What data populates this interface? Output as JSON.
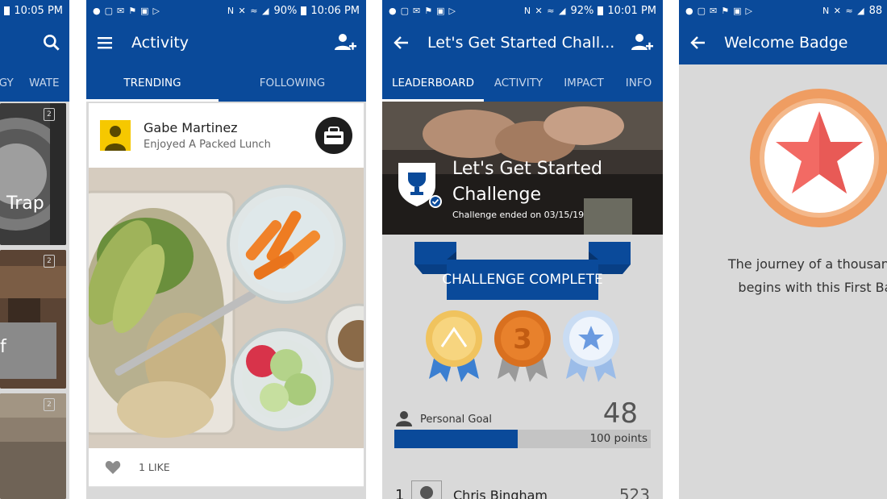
{
  "colors": {
    "brand_blue": "#0a4a9a",
    "tab_inactive": "#c6d5ea",
    "badge_orange": "#ef9d62",
    "star_red": "#f26a64"
  },
  "screens": [
    {
      "status_time": "10:05 PM",
      "tabs": [
        "RGY",
        "WATE"
      ],
      "card_badge": "2",
      "card_text_1": "Trap",
      "card_text_2": "f"
    },
    {
      "status_battery": "90%",
      "status_time": "10:06 PM",
      "title": "Activity",
      "tabs": [
        "TRENDING",
        "FOLLOWING"
      ],
      "post": {
        "user": "Gabe Martinez",
        "action": "Enjoyed A Packed Lunch",
        "likes_label": "1 LIKE"
      }
    },
    {
      "status_battery": "92%",
      "status_time": "10:01 PM",
      "title": "Let's Get Started Chall...",
      "tabs": [
        "LEADERBOARD",
        "ACTIVITY",
        "IMPACT",
        "INFO"
      ],
      "hero_title": "Let's Get Started Challenge",
      "hero_sub": "Challenge ended on 03/15/19",
      "banner": "CHALLENGE COMPLETE",
      "medal_icons": [
        "mountain-medal-icon",
        "number-3-medal-icon",
        "star-medal-icon"
      ],
      "goal": {
        "label": "Personal Goal",
        "value": "48",
        "points": "100 points",
        "progress": 0.48
      },
      "leaderboard": [
        {
          "rank": "1",
          "name": "Chris Bingham",
          "score": "523"
        }
      ]
    },
    {
      "status_battery": "88",
      "title": "Welcome Badge",
      "text_line1": "The journey of a thousand B",
      "text_line2": "begins with this First Bad"
    }
  ]
}
